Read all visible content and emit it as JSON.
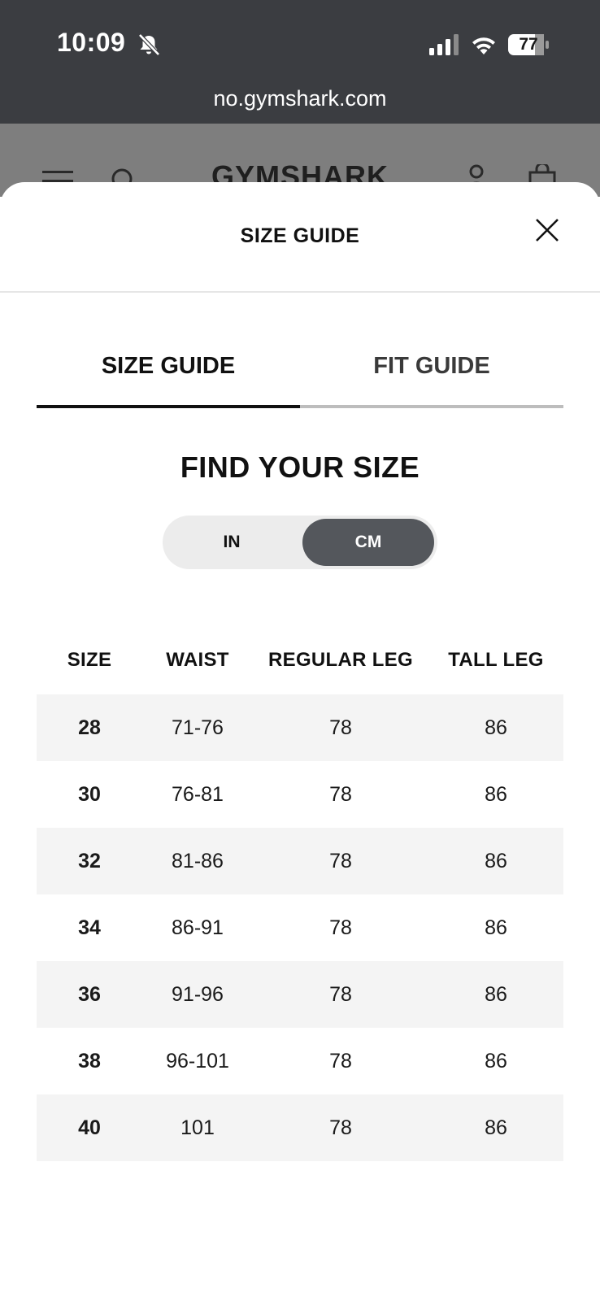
{
  "status_bar": {
    "time": "10:09",
    "battery": "77",
    "icons": [
      "bell-off-icon",
      "signal-icon",
      "wifi-icon",
      "battery-icon"
    ]
  },
  "browser": {
    "url": "no.gymshark.com"
  },
  "site_header": {
    "logo": "GYMSHARK",
    "icons": [
      "menu-icon",
      "search-icon",
      "account-icon",
      "bag-icon"
    ]
  },
  "modal": {
    "title": "SIZE GUIDE",
    "close_icon": "close-icon"
  },
  "tabs": [
    {
      "label": "SIZE GUIDE",
      "active": true
    },
    {
      "label": "FIT GUIDE",
      "active": false
    }
  ],
  "find_title": "FIND YOUR SIZE",
  "unit_toggle": {
    "options": [
      "IN",
      "CM"
    ],
    "selected": "CM"
  },
  "size_table": {
    "headers": [
      "SIZE",
      "WAIST",
      "REGULAR LEG",
      "TALL LEG"
    ],
    "rows": [
      [
        "28",
        "71-76",
        "78",
        "86"
      ],
      [
        "30",
        "76-81",
        "78",
        "86"
      ],
      [
        "32",
        "81-86",
        "78",
        "86"
      ],
      [
        "34",
        "86-91",
        "78",
        "86"
      ],
      [
        "36",
        "91-96",
        "78",
        "86"
      ],
      [
        "38",
        "96-101",
        "78",
        "86"
      ],
      [
        "40",
        "101",
        "78",
        "86"
      ]
    ]
  },
  "colors": {
    "status_bar": "#3b3d41",
    "dimmed_header": "#7e7e7e",
    "active_toggle": "#54575c",
    "row_alt": "#f4f4f4",
    "text": "#111111"
  }
}
